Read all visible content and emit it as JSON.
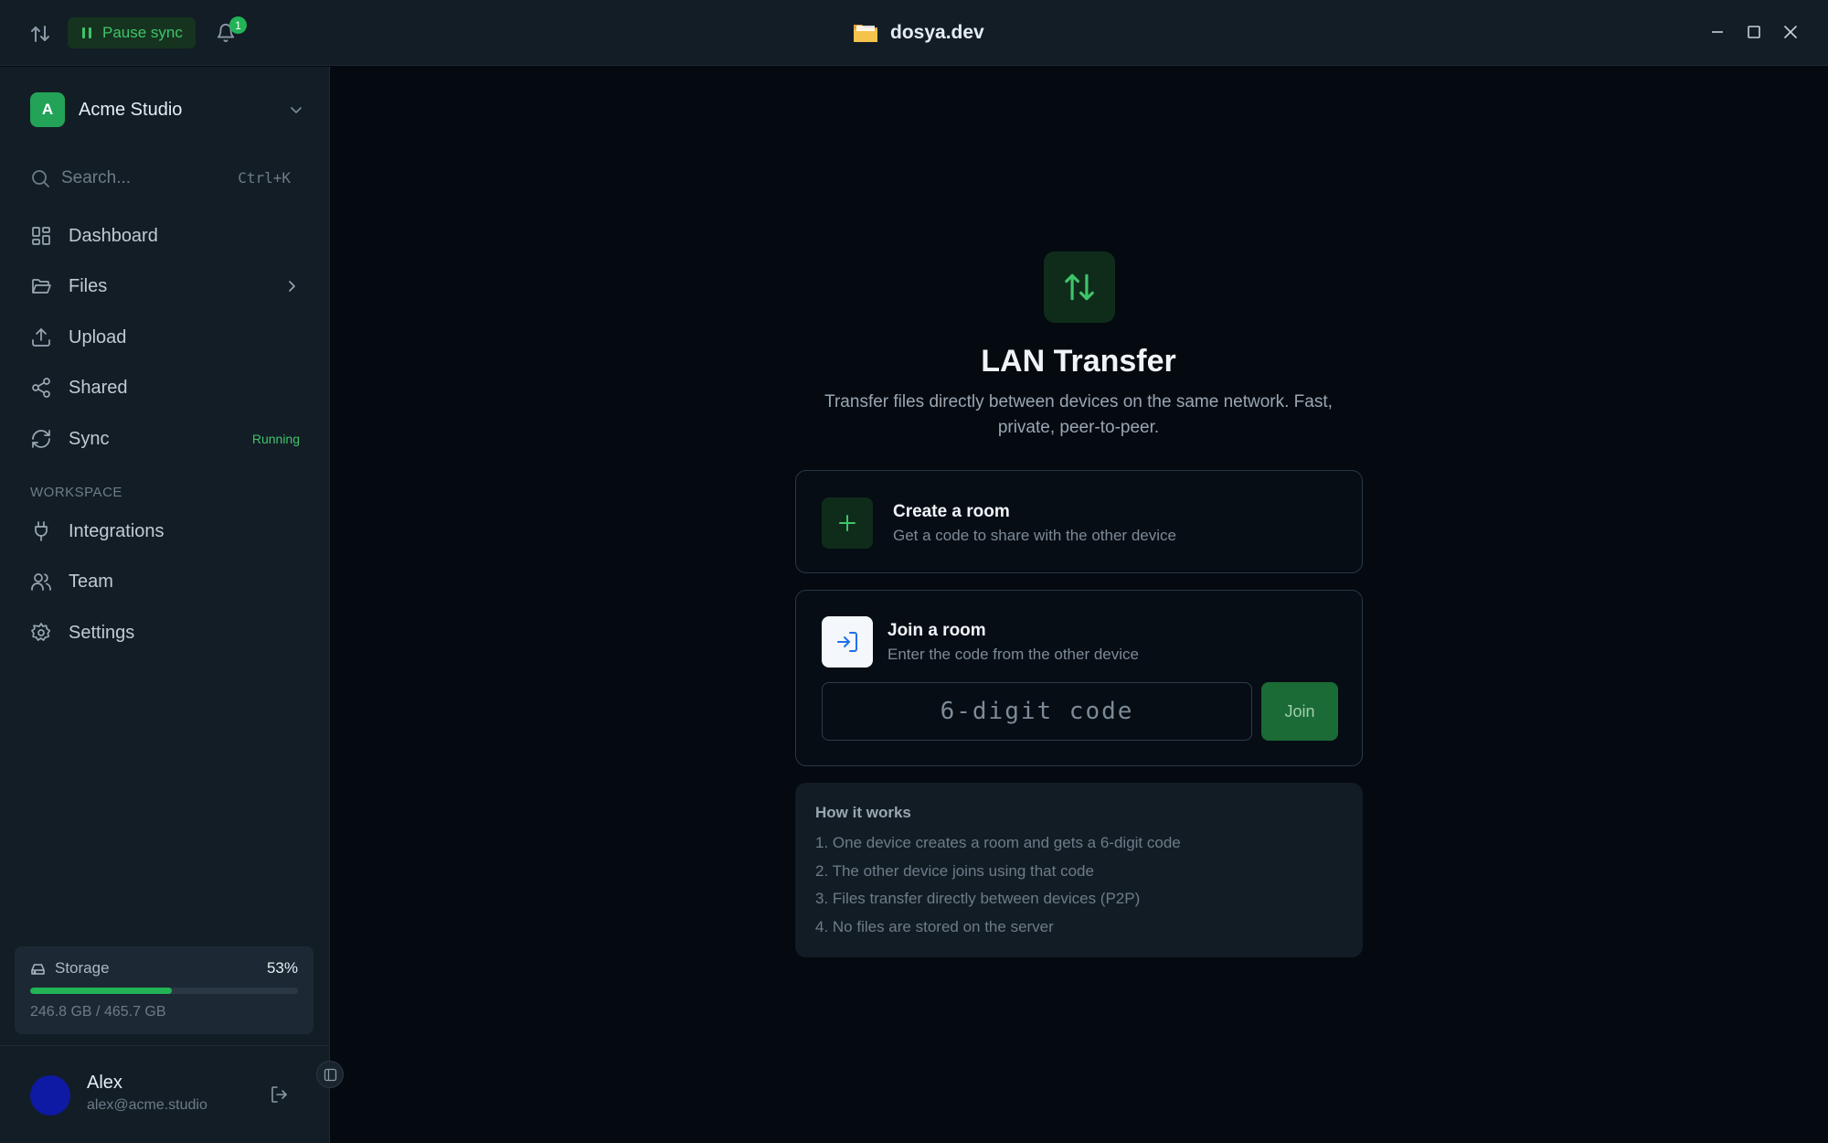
{
  "titlebar": {
    "pause_label": "Pause sync",
    "notification_count": "1",
    "app_title": "dosya.dev"
  },
  "sidebar": {
    "workspace": {
      "initial": "A",
      "name": "Acme Studio"
    },
    "search": {
      "placeholder": "Search...",
      "shortcut": "Ctrl+K"
    },
    "nav": [
      {
        "label": "Dashboard",
        "icon": "grid-icon"
      },
      {
        "label": "Files",
        "icon": "folder-open-icon"
      },
      {
        "label": "Upload",
        "icon": "upload-icon"
      },
      {
        "label": "Shared",
        "icon": "share-icon"
      },
      {
        "label": "Sync",
        "icon": "refresh-icon",
        "status": "Running"
      }
    ],
    "section_label": "WORKSPACE",
    "workspace_nav": [
      {
        "label": "Integrations",
        "icon": "plug-icon"
      },
      {
        "label": "Team",
        "icon": "users-icon"
      },
      {
        "label": "Settings",
        "icon": "gear-icon"
      }
    ],
    "storage": {
      "label": "Storage",
      "percent_label": "53%",
      "fraction": 0.53,
      "size_label": "246.8 GB / 465.7 GB"
    },
    "user": {
      "name": "Alex",
      "email": "alex@acme.studio"
    }
  },
  "main": {
    "title": "LAN Transfer",
    "subtitle": "Transfer files directly between devices on the same network. Fast, private, peer-to-peer.",
    "create_room": {
      "title": "Create a room",
      "description": "Get a code to share with the other device"
    },
    "join_room": {
      "title": "Join a room",
      "description": "Enter the code from the other device",
      "code_placeholder": "6-digit code",
      "join_label": "Join"
    },
    "how_it_works": {
      "title": "How it works",
      "steps": [
        "1. One device creates a room and gets a 6-digit code",
        "2. The other device joins using that code",
        "3. Files transfer directly between devices (P2P)",
        "4. No files are stored on the server"
      ]
    }
  },
  "colors": {
    "accent_green": "#22b357",
    "background": "#040a10",
    "sidebar": "#131d26"
  }
}
